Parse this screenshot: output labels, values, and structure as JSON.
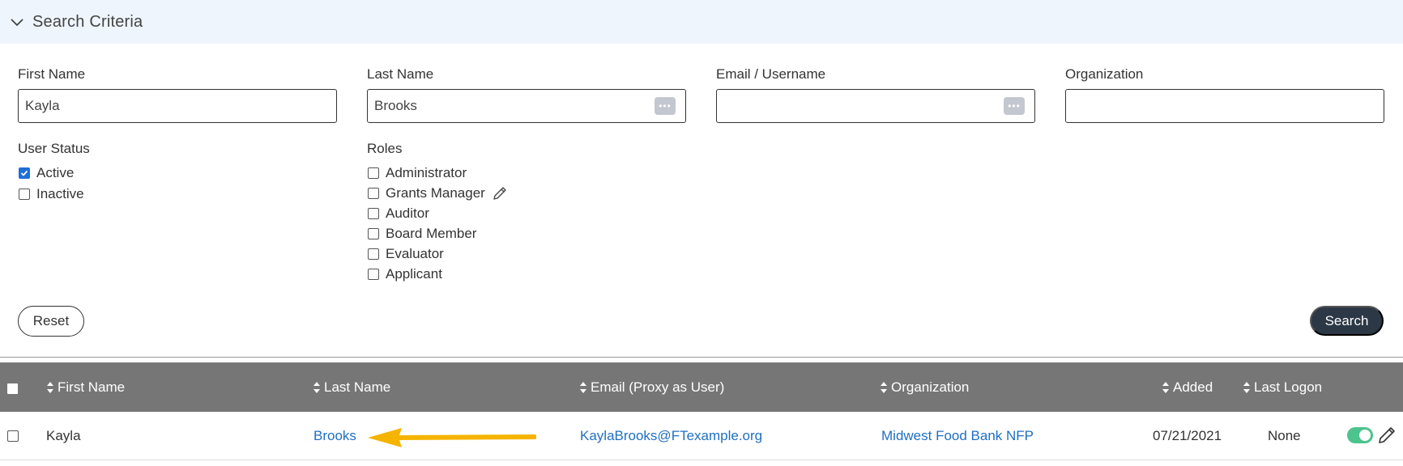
{
  "criteria": {
    "title": "Search Criteria",
    "first_name": {
      "label": "First Name",
      "value": "Kayla"
    },
    "last_name": {
      "label": "Last Name",
      "value": "Brooks"
    },
    "email": {
      "label": "Email / Username",
      "value": ""
    },
    "organization": {
      "label": "Organization",
      "value": ""
    },
    "user_status": {
      "label": "User Status",
      "options": [
        {
          "label": "Active",
          "checked": true
        },
        {
          "label": "Inactive",
          "checked": false
        }
      ]
    },
    "roles": {
      "label": "Roles",
      "options": [
        {
          "label": "Administrator",
          "checked": false
        },
        {
          "label": "Grants Manager",
          "checked": false
        },
        {
          "label": "Auditor",
          "checked": false
        },
        {
          "label": "Board Member",
          "checked": false
        },
        {
          "label": "Evaluator",
          "checked": false
        },
        {
          "label": "Applicant",
          "checked": false
        }
      ]
    },
    "reset_label": "Reset",
    "search_label": "Search"
  },
  "table": {
    "columns": [
      "First Name",
      "Last Name",
      "Email (Proxy as User)",
      "Organization",
      "Added",
      "Last Logon"
    ],
    "rows": [
      {
        "first_name": "Kayla",
        "last_name": "Brooks",
        "email": "KaylaBrooks@FTexample.org",
        "organization": "Midwest Food Bank NFP",
        "added": "07/21/2021",
        "last_logon": "None",
        "active_toggle": true
      }
    ]
  },
  "icons": {
    "chevron": "chevron-down-icon",
    "ellipsis": "ellipsis-icon",
    "pencil": "pencil-icon",
    "sort": "sort-icon",
    "arrow": "arrow-left-annotation"
  },
  "colors": {
    "header_bg": "#eef5fc",
    "table_head": "#767676",
    "link": "#1f6fc4",
    "search_btn": "#2d3846",
    "toggle_on": "#4cc48d",
    "checkbox_on": "#1f6fd6",
    "annotation_arrow": "#f5b400"
  }
}
